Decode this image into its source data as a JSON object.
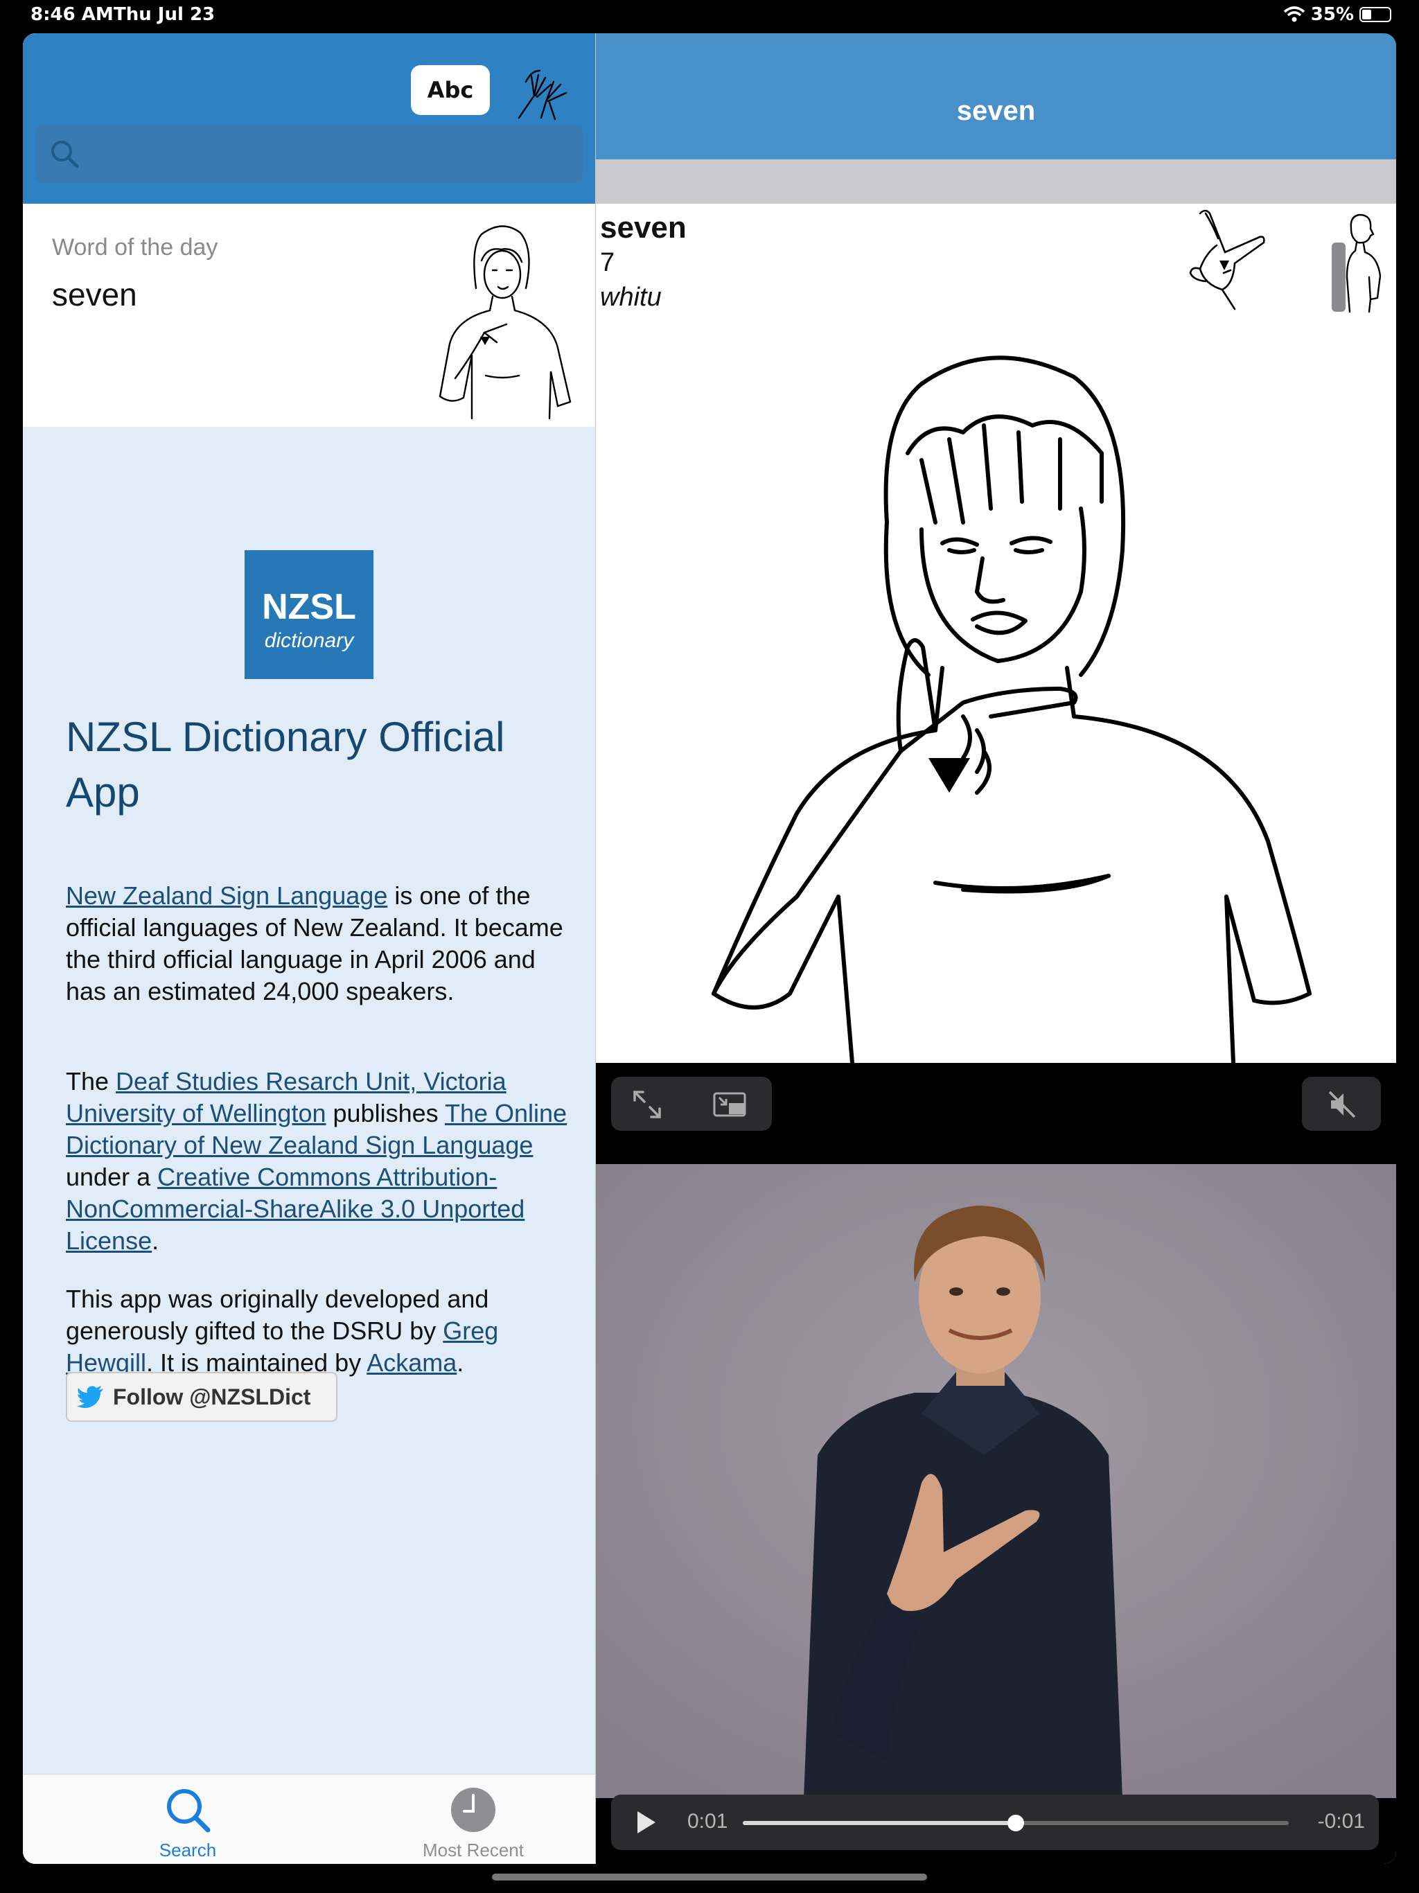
{
  "status": {
    "time": "8:46 AM",
    "date": "Thu Jul 23",
    "battery": "35%",
    "battery_level": 0.35
  },
  "left": {
    "abc_label": "Abc",
    "search_placeholder": "",
    "wotd_label": "Word of the day",
    "wotd_word": "seven",
    "logo": {
      "line1": "NZSL",
      "line2": "dictionary"
    },
    "title": "NZSL Dictionary Official App",
    "p1": {
      "link": "New Zealand Sign Language",
      "text": " is one of the official languages of New Zealand. It became the third official language in April 2006 and has an estimated 24,000 speakers."
    },
    "p2": {
      "t1": "The ",
      "l1": "Deaf Studies Resarch Unit, Victoria University of Wellington",
      "t2": " publishes ",
      "l2": "The Online Dictionary of New Zealand Sign Language",
      "t3": " under a ",
      "l3": "Creative Commons Attribution-NonCommercial-ShareAlike 3.0 Unported License",
      "t4": "."
    },
    "p3": {
      "t1": "This app was originally developed and generously gifted to the DSRU by ",
      "l1": "Greg Hewgill",
      "t2": ". It is maintained by ",
      "l2": "Ackama",
      "t3": "."
    },
    "follow_label": "Follow @NZSLDict",
    "tabs": [
      {
        "label": "Search",
        "color": "#1a7fdc"
      },
      {
        "label": "Most Recent",
        "color": "#8e8e93"
      }
    ]
  },
  "right": {
    "header_title": "seven",
    "word": "seven",
    "number": "7",
    "maori": "whitu",
    "video": {
      "current": "0:01",
      "remaining": "-0:01",
      "progress": 0.5
    }
  },
  "colors": {
    "header_left": "#2e81c2",
    "header_right": "#4a90c8",
    "link": "#1b4f7a",
    "title": "#17476f"
  }
}
